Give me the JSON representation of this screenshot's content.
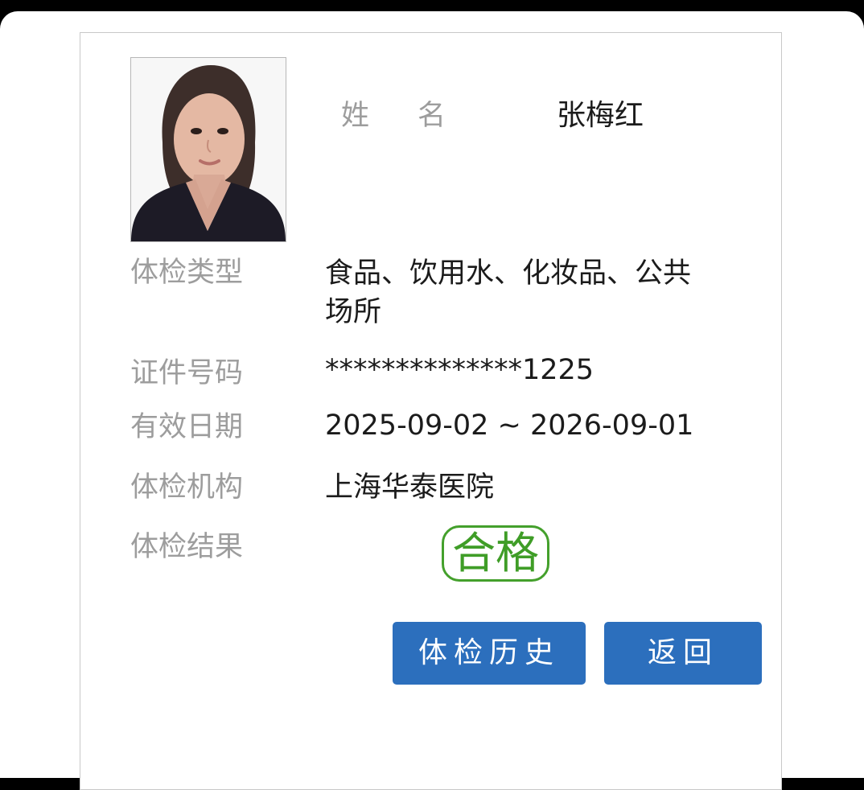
{
  "profile": {
    "photo_alt": "证件照",
    "name_label": "姓名",
    "name": "张梅红"
  },
  "fields": {
    "exam_type_label": "体检类型",
    "exam_type_value": "食品、饮用水、化妆品、公共场所",
    "id_label": "证件号码",
    "id_value": "**************1225",
    "validity_label": "有效日期",
    "validity_value": "2025-09-02 ~ 2026-09-01",
    "institution_label": "体检机构",
    "institution_value": "上海华泰医院",
    "result_label": "体检结果",
    "result_value": "合格"
  },
  "buttons": {
    "history": "体检历史",
    "back": "返回"
  },
  "colors": {
    "primary_button": "#2c6fbd",
    "pass_stamp": "#44a02c",
    "label_text": "#9d9d9d",
    "value_text": "#1b1b1b"
  }
}
